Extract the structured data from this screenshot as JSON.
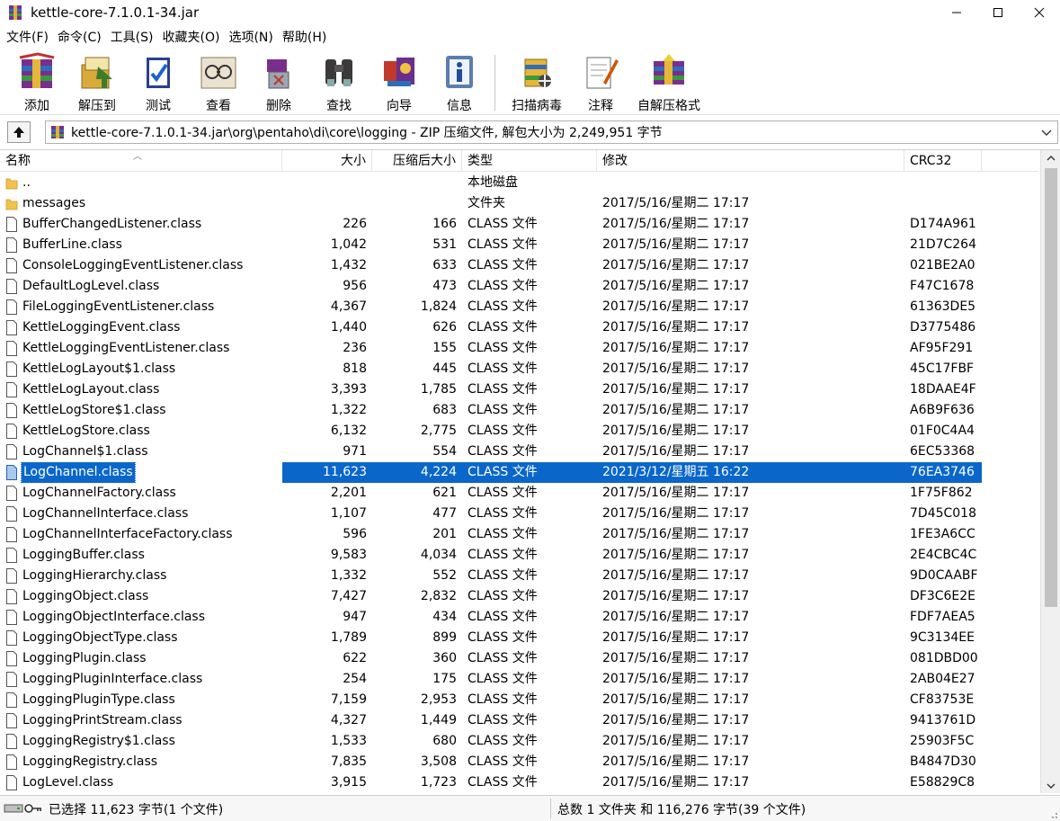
{
  "window": {
    "title": "kettle-core-7.1.0.1-34.jar"
  },
  "menu": [
    "文件(F)",
    "命令(C)",
    "工具(S)",
    "收藏夹(O)",
    "选项(N)",
    "帮助(H)"
  ],
  "toolbar": [
    {
      "label": "添加",
      "icon": "add-archive-icon"
    },
    {
      "label": "解压到",
      "icon": "extract-to-icon"
    },
    {
      "label": "测试",
      "icon": "test-icon"
    },
    {
      "label": "查看",
      "icon": "view-icon"
    },
    {
      "label": "删除",
      "icon": "delete-icon"
    },
    {
      "label": "查找",
      "icon": "find-icon"
    },
    {
      "label": "向导",
      "icon": "wizard-icon"
    },
    {
      "label": "信息",
      "icon": "info-icon"
    },
    {
      "label": "扫描病毒",
      "icon": "virus-scan-icon"
    },
    {
      "label": "注释",
      "icon": "comment-icon"
    },
    {
      "label": "自解压格式",
      "icon": "sfx-icon"
    }
  ],
  "address": {
    "path": "kettle-core-7.1.0.1-34.jar\\org\\pentaho\\di\\core\\logging - ZIP 压缩文件, 解包大小为 2,249,951 字节"
  },
  "columns": {
    "name": "名称",
    "size": "大小",
    "packed": "压缩后大小",
    "type": "类型",
    "modified": "修改",
    "crc": "CRC32"
  },
  "files": [
    {
      "name": "..",
      "size": "",
      "packed": "",
      "type": "本地磁盘",
      "modified": "",
      "crc": "",
      "kind": "folder"
    },
    {
      "name": "messages",
      "size": "",
      "packed": "",
      "type": "文件夹",
      "modified": "2017/5/16/星期二 17:17",
      "crc": "",
      "kind": "folder"
    },
    {
      "name": "BufferChangedListener.class",
      "size": "226",
      "packed": "166",
      "type": "CLASS 文件",
      "modified": "2017/5/16/星期二 17:17",
      "crc": "D174A961",
      "kind": "file"
    },
    {
      "name": "BufferLine.class",
      "size": "1,042",
      "packed": "531",
      "type": "CLASS 文件",
      "modified": "2017/5/16/星期二 17:17",
      "crc": "21D7C264",
      "kind": "file"
    },
    {
      "name": "ConsoleLoggingEventListener.class",
      "size": "1,432",
      "packed": "633",
      "type": "CLASS 文件",
      "modified": "2017/5/16/星期二 17:17",
      "crc": "021BE2A0",
      "kind": "file"
    },
    {
      "name": "DefaultLogLevel.class",
      "size": "956",
      "packed": "473",
      "type": "CLASS 文件",
      "modified": "2017/5/16/星期二 17:17",
      "crc": "F47C1678",
      "kind": "file"
    },
    {
      "name": "FileLoggingEventListener.class",
      "size": "4,367",
      "packed": "1,824",
      "type": "CLASS 文件",
      "modified": "2017/5/16/星期二 17:17",
      "crc": "61363DE5",
      "kind": "file"
    },
    {
      "name": "KettleLoggingEvent.class",
      "size": "1,440",
      "packed": "626",
      "type": "CLASS 文件",
      "modified": "2017/5/16/星期二 17:17",
      "crc": "D3775486",
      "kind": "file"
    },
    {
      "name": "KettleLoggingEventListener.class",
      "size": "236",
      "packed": "155",
      "type": "CLASS 文件",
      "modified": "2017/5/16/星期二 17:17",
      "crc": "AF95F291",
      "kind": "file"
    },
    {
      "name": "KettleLogLayout$1.class",
      "size": "818",
      "packed": "445",
      "type": "CLASS 文件",
      "modified": "2017/5/16/星期二 17:17",
      "crc": "45C17FBF",
      "kind": "file"
    },
    {
      "name": "KettleLogLayout.class",
      "size": "3,393",
      "packed": "1,785",
      "type": "CLASS 文件",
      "modified": "2017/5/16/星期二 17:17",
      "crc": "18DAAE4F",
      "kind": "file"
    },
    {
      "name": "KettleLogStore$1.class",
      "size": "1,322",
      "packed": "683",
      "type": "CLASS 文件",
      "modified": "2017/5/16/星期二 17:17",
      "crc": "A6B9F636",
      "kind": "file"
    },
    {
      "name": "KettleLogStore.class",
      "size": "6,132",
      "packed": "2,775",
      "type": "CLASS 文件",
      "modified": "2017/5/16/星期二 17:17",
      "crc": "01F0C4A4",
      "kind": "file"
    },
    {
      "name": "LogChannel$1.class",
      "size": "971",
      "packed": "554",
      "type": "CLASS 文件",
      "modified": "2017/5/16/星期二 17:17",
      "crc": "6EC53368",
      "kind": "file"
    },
    {
      "name": "LogChannel.class",
      "size": "11,623",
      "packed": "4,224",
      "type": "CLASS 文件",
      "modified": "2021/3/12/星期五 16:22",
      "crc": "76EA3746",
      "kind": "file",
      "selected": true
    },
    {
      "name": "LogChannelFactory.class",
      "size": "2,201",
      "packed": "621",
      "type": "CLASS 文件",
      "modified": "2017/5/16/星期二 17:17",
      "crc": "1F75F862",
      "kind": "file"
    },
    {
      "name": "LogChannelInterface.class",
      "size": "1,107",
      "packed": "477",
      "type": "CLASS 文件",
      "modified": "2017/5/16/星期二 17:17",
      "crc": "7D45C018",
      "kind": "file"
    },
    {
      "name": "LogChannelInterfaceFactory.class",
      "size": "596",
      "packed": "201",
      "type": "CLASS 文件",
      "modified": "2017/5/16/星期二 17:17",
      "crc": "1FE3A6CC",
      "kind": "file"
    },
    {
      "name": "LoggingBuffer.class",
      "size": "9,583",
      "packed": "4,034",
      "type": "CLASS 文件",
      "modified": "2017/5/16/星期二 17:17",
      "crc": "2E4CBC4C",
      "kind": "file"
    },
    {
      "name": "LoggingHierarchy.class",
      "size": "1,332",
      "packed": "552",
      "type": "CLASS 文件",
      "modified": "2017/5/16/星期二 17:17",
      "crc": "9D0CAABF",
      "kind": "file"
    },
    {
      "name": "LoggingObject.class",
      "size": "7,427",
      "packed": "2,832",
      "type": "CLASS 文件",
      "modified": "2017/5/16/星期二 17:17",
      "crc": "DF3C6E2E",
      "kind": "file"
    },
    {
      "name": "LoggingObjectInterface.class",
      "size": "947",
      "packed": "434",
      "type": "CLASS 文件",
      "modified": "2017/5/16/星期二 17:17",
      "crc": "FDF7AEA5",
      "kind": "file"
    },
    {
      "name": "LoggingObjectType.class",
      "size": "1,789",
      "packed": "899",
      "type": "CLASS 文件",
      "modified": "2017/5/16/星期二 17:17",
      "crc": "9C3134EE",
      "kind": "file"
    },
    {
      "name": "LoggingPlugin.class",
      "size": "622",
      "packed": "360",
      "type": "CLASS 文件",
      "modified": "2017/5/16/星期二 17:17",
      "crc": "081DBD00",
      "kind": "file"
    },
    {
      "name": "LoggingPluginInterface.class",
      "size": "254",
      "packed": "175",
      "type": "CLASS 文件",
      "modified": "2017/5/16/星期二 17:17",
      "crc": "2AB04E27",
      "kind": "file"
    },
    {
      "name": "LoggingPluginType.class",
      "size": "7,159",
      "packed": "2,953",
      "type": "CLASS 文件",
      "modified": "2017/5/16/星期二 17:17",
      "crc": "CF83753E",
      "kind": "file"
    },
    {
      "name": "LoggingPrintStream.class",
      "size": "4,327",
      "packed": "1,449",
      "type": "CLASS 文件",
      "modified": "2017/5/16/星期二 17:17",
      "crc": "9413761D",
      "kind": "file"
    },
    {
      "name": "LoggingRegistry$1.class",
      "size": "1,533",
      "packed": "680",
      "type": "CLASS 文件",
      "modified": "2017/5/16/星期二 17:17",
      "crc": "25903F5C",
      "kind": "file"
    },
    {
      "name": "LoggingRegistry.class",
      "size": "7,835",
      "packed": "3,508",
      "type": "CLASS 文件",
      "modified": "2017/5/16/星期二 17:17",
      "crc": "B4847D30",
      "kind": "file"
    },
    {
      "name": "LogLevel.class",
      "size": "3,915",
      "packed": "1,723",
      "type": "CLASS 文件",
      "modified": "2017/5/16/星期二 17:17",
      "crc": "E58829C8",
      "kind": "file"
    }
  ],
  "status": {
    "left": "已选择 11,623 字节(1 个文件)",
    "right": "总数 1 文件夹 和 116,276 字节(39 个文件)"
  },
  "colors": {
    "selection": "#0a67c9",
    "folder": "#f2c14e"
  }
}
